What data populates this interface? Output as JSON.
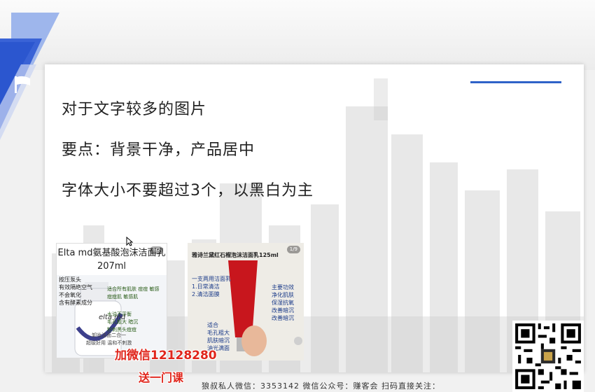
{
  "slide": {
    "lines": [
      "对于文字较多的图片",
      "要点：背景干净，产品居中",
      "字体大小不要超过3个，以黑白为主"
    ]
  },
  "product1": {
    "title_line1": "Elta md氨基酸泡沫洁面乳",
    "title_line2": "207ml",
    "pager": "1/2",
    "notes_left": [
      "按压泵头",
      "有效隔绝空气",
      "不会氧化",
      "含有酵素成分"
    ],
    "notes_right": [
      "适合所有肌肤 痘痘 敏感",
      "痘痘肌 敏感肌",
      "水油不平衡",
      "毛孔粗大 暗沉",
      "粉刺黑头痘痘"
    ],
    "notes_bottom": [
      "卸妆洁面二合一",
      "超级好用 温和不刺激"
    ],
    "bottle_brand": "elta md"
  },
  "product2": {
    "title": "雅诗兰黛红石榴泡沫洁面乳125ml",
    "pager": "1/9",
    "notes_left": [
      "一支两用洁面乳",
      "1.日常清洁",
      "2.清洁面膜"
    ],
    "notes_left_bottom": [
      "适合",
      "毛孔粗大",
      "肌肤暗沉",
      "油光满面"
    ],
    "notes_right": [
      "主要功效",
      "净化肌肤",
      "保湿抗氧",
      "改善暗沉",
      "改善暗沉"
    ]
  },
  "watermark": {
    "line1": "加微信12128280",
    "line2": "送一门课"
  },
  "footer": {
    "text": "狼叔私人微信：3353142   微信公众号：赚客会   扫码直接关注："
  },
  "colors": {
    "accent": "#2f62c8",
    "watermark_red": "#e0251b",
    "bottle_red": "#c8161d"
  },
  "icons": [
    "flag-icon",
    "cursor-icon",
    "qr-code"
  ]
}
